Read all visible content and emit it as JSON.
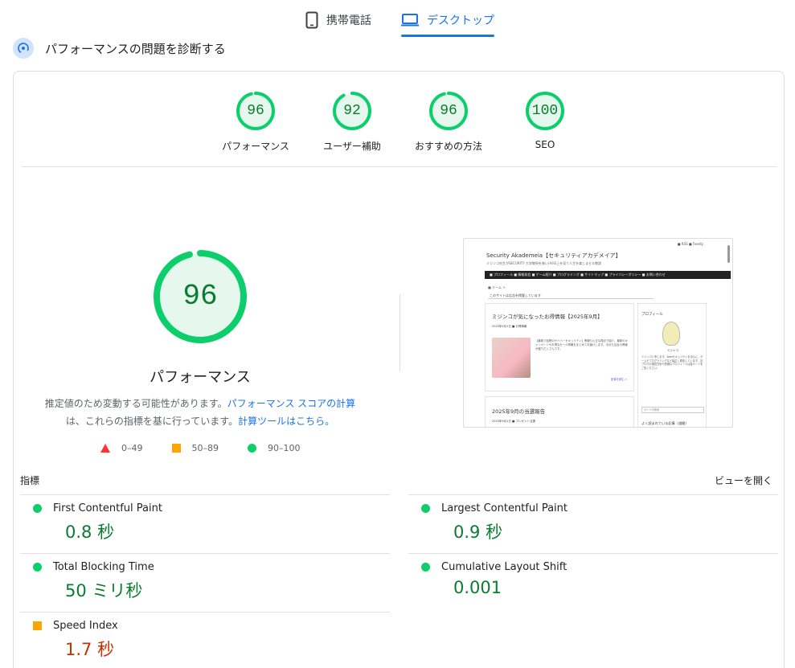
{
  "tabs": {
    "mobile": "携帯電話",
    "desktop": "デスクトップ"
  },
  "diagnose_title": "パフォーマンスの問題を診断する",
  "gauges": [
    {
      "score": "96",
      "label": "パフォーマンス",
      "value": 96
    },
    {
      "score": "92",
      "label": "ユーザー補助",
      "value": 92
    },
    {
      "score": "96",
      "label": "おすすめの方法",
      "value": 96
    },
    {
      "score": "100",
      "label": "SEO",
      "value": 100
    }
  ],
  "main": {
    "score": "96",
    "value": 96,
    "label": "パフォーマンス",
    "desc_prefix": "推定値のため変動する可能性があります。",
    "desc_link1": "パフォーマンス スコアの計算",
    "desc_mid": "は、これらの指標を基に行っています。",
    "desc_link2": "計算ツールはこちら。"
  },
  "legend": {
    "fail": "0–49",
    "average": "50–89",
    "pass": "90–100"
  },
  "screenshot": {
    "top_links": "■ RSS   ■ Feedly",
    "site_title": "Security Akademeia【セキュリティアカデメイア】",
    "site_sub": "ミジンコ先生がSECURITY 大学教授を装い(※)IS上を見て人生を楽しませる教訓",
    "nav": "■ プロフィール   ■ 情報発信   ■ ゲーム紹介   ■ プログラミング   ■ サイトマップ   ■ プライバシーポリシー   ■ お問い合わせ",
    "crumb": "■ ホーム >",
    "select": "このサイトは広告を掲載しています",
    "post1_title": "ミジンコが気になったお得情報【2025年9月】",
    "post1_meta": "2025年9月1日  ■ お得情報",
    "post1_text": "【最新で話題のサイバーセキュリティ】情報も公正な視点で紹介。最新のキャンペーンやお得なセール情報をまとめてお届けします。今月も注目の情報が盛りだくさんです。",
    "post1_more": "記事を読む »",
    "post2_title": "2025年9月の当選報告",
    "post2_meta": "2025年9月1日  ■ プレゼント当選",
    "side_title": "プロフィール",
    "side_name": "ミジンコ",
    "side_text": "ミジンコと申します。Webセキュリティを中心に、ゲームやプログラミングなど幅広く発信しています。当ブログの運営方針や詳細なプロフィールは各ページをご覧ください。",
    "side_search": "サイト内検索",
    "side_h2": "よく読まれている記事（週間）"
  },
  "metrics": {
    "heading": "指標",
    "expand": "ビューを開く",
    "items": [
      {
        "name": "First Contentful Paint",
        "value": "0.8 秒",
        "status": "pass"
      },
      {
        "name": "Largest Contentful Paint",
        "value": "0.9 秒",
        "status": "pass"
      },
      {
        "name": "Total Blocking Time",
        "value": "50 ミリ秒",
        "status": "pass"
      },
      {
        "name": "Cumulative Layout Shift",
        "value": "0.001",
        "status": "pass"
      },
      {
        "name": "Speed Index",
        "value": "1.7 秒",
        "status": "average"
      }
    ]
  },
  "colors": {
    "pass": "#0cce6b",
    "pass_text": "#0a7c2f",
    "pass_bg": "#e6f8ee",
    "average": "#ffa400",
    "average_text": "#c33300",
    "fail": "#ff3333",
    "accent": "#1a73e8"
  }
}
